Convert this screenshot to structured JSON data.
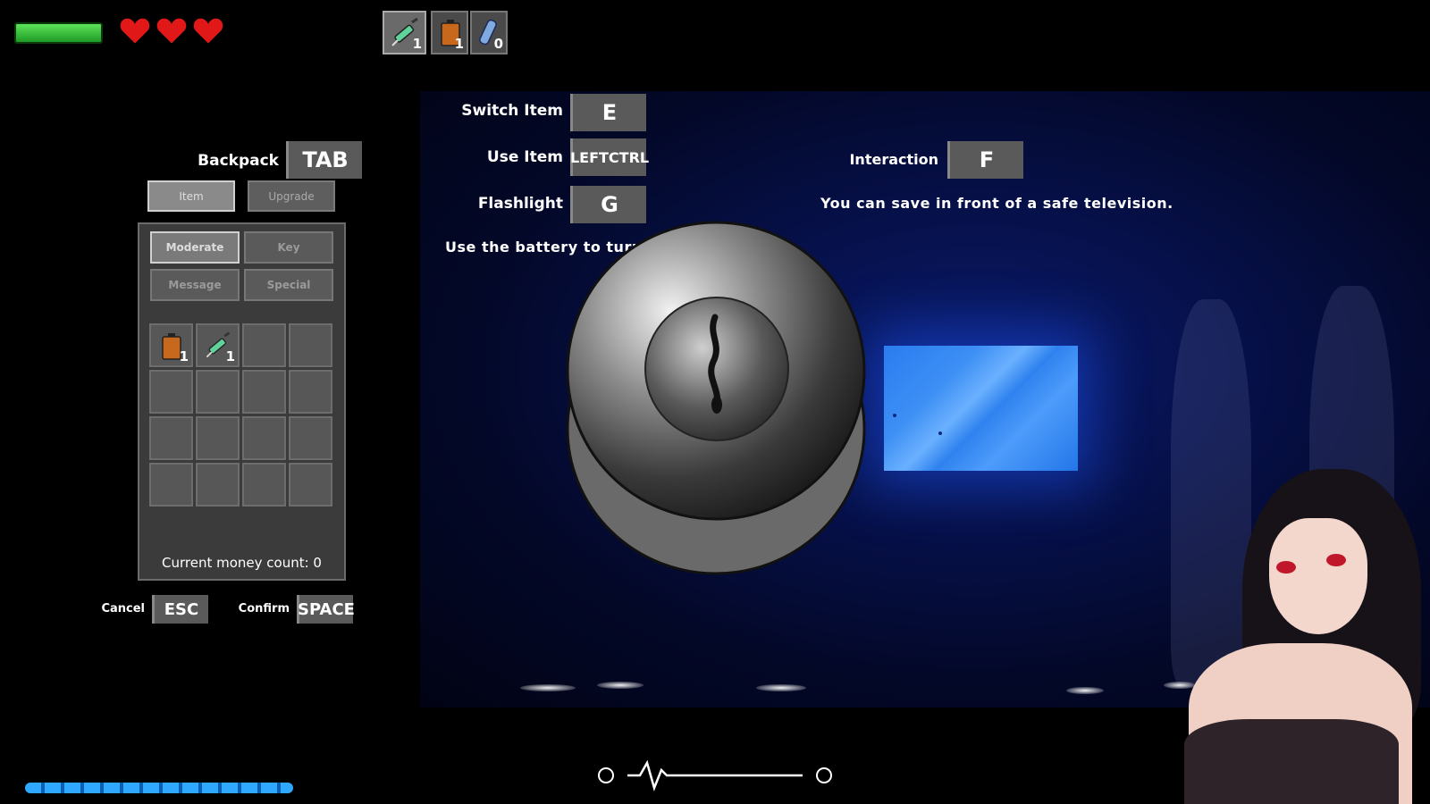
{
  "hud": {
    "hearts": 3,
    "quick_items": [
      {
        "icon": "syringe-icon",
        "count": "1",
        "selected": true
      },
      {
        "icon": "battery-icon",
        "count": "1",
        "selected": false
      },
      {
        "icon": "bandage-icon",
        "count": "0",
        "selected": false
      }
    ]
  },
  "controls": {
    "switch_item": {
      "label": "Switch Item",
      "key": "E"
    },
    "use_item": {
      "label": "Use Item",
      "key": "LEFTCTRL"
    },
    "flashlight": {
      "label": "Flashlight",
      "key": "G"
    },
    "interaction": {
      "label": "Interaction",
      "key": "F"
    },
    "backpack": {
      "label": "Backpack",
      "key": "TAB"
    }
  },
  "hints": {
    "battery": "Use the battery to turn",
    "save": "You can save in front of a safe television."
  },
  "inventory": {
    "tabs": [
      "Item",
      "Upgrade"
    ],
    "categories": [
      "Moderate",
      "Key",
      "Message",
      "Special"
    ],
    "items": [
      {
        "icon": "battery-icon",
        "count": "1"
      },
      {
        "icon": "syringe-icon",
        "count": "1"
      }
    ],
    "money_text": "Current money count: 0"
  },
  "footer": {
    "cancel_label": "Cancel",
    "cancel_key": "ESC",
    "confirm_label": "Confirm",
    "confirm_key": "SPACE"
  },
  "colors": {
    "health": "#3cc83c",
    "heart": "#e01818",
    "tv": "#3d8ff5",
    "stamina": "#2fa8ff"
  }
}
